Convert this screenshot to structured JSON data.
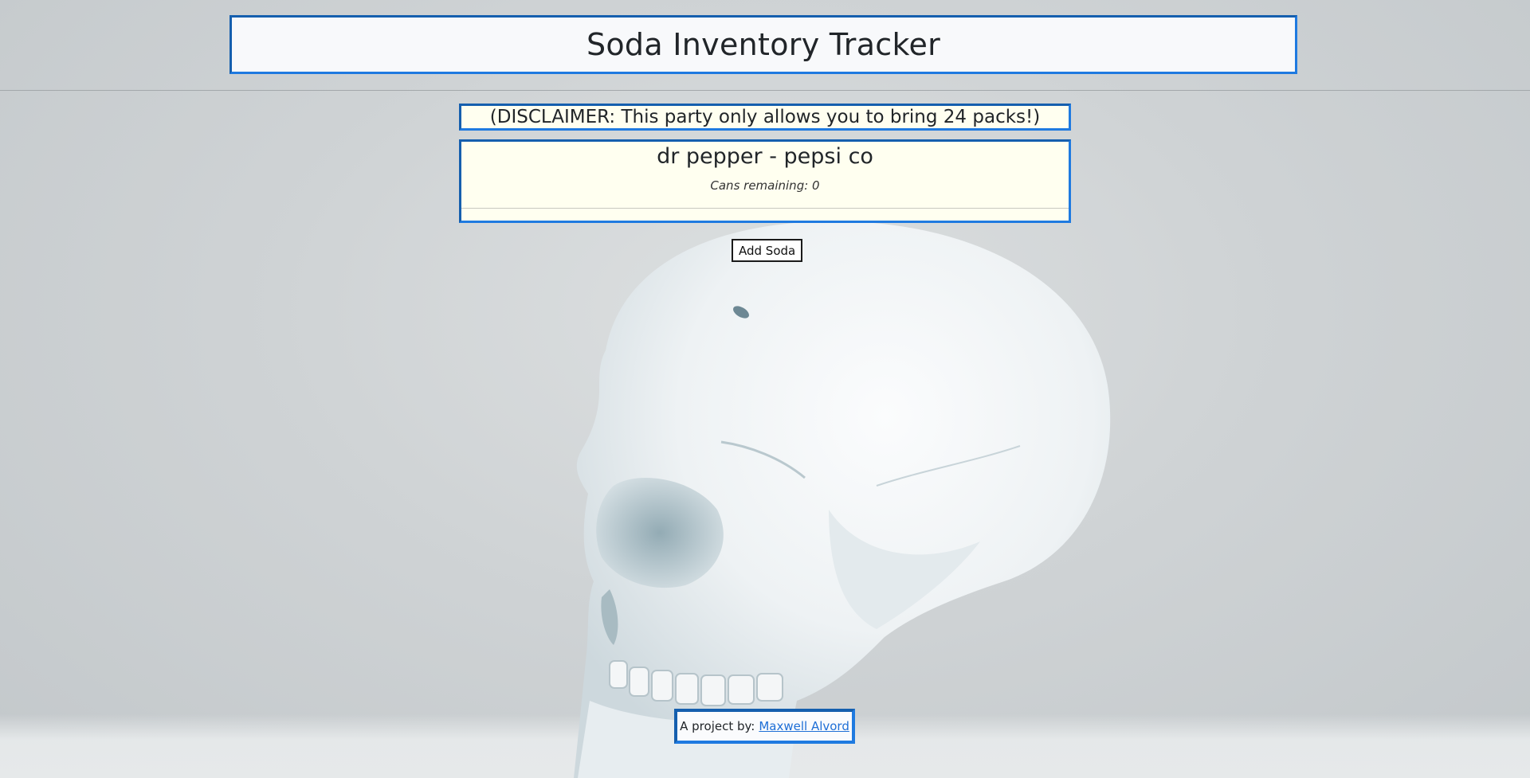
{
  "header": {
    "title": "Soda Inventory Tracker"
  },
  "disclaimer": {
    "text": "(DISCLAIMER: This party only allows you to bring 24 packs!)"
  },
  "sodas": [
    {
      "name": "dr pepper - pepsi co",
      "cans_remaining": "Cans remaining: 0"
    }
  ],
  "actions": {
    "add_soda_label": "Add Soda"
  },
  "footer": {
    "prefix": "A project by:",
    "author_link": "Maxwell Alvord"
  },
  "colors": {
    "accent_border": "#1f7ae0",
    "card_background": "#fffff0",
    "link": "#1f6fd6"
  },
  "background": {
    "image": "skull-image"
  }
}
